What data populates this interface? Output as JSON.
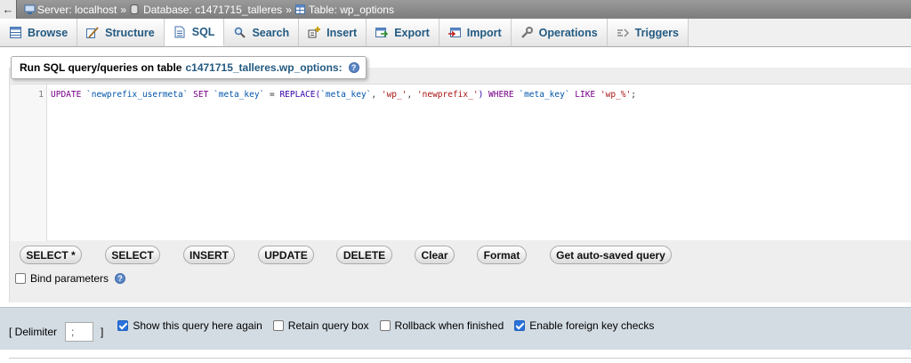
{
  "breadcrumb": {
    "back_glyph": "←",
    "server": "Server: localhost",
    "database": "Database: c1471715_talleres",
    "table": "Table: wp_options",
    "separator": "»"
  },
  "tabs": [
    {
      "label": "Browse",
      "icon": "browse-icon",
      "active": false
    },
    {
      "label": "Structure",
      "icon": "structure-icon",
      "active": false
    },
    {
      "label": "SQL",
      "icon": "sql-icon",
      "active": true
    },
    {
      "label": "Search",
      "icon": "search-icon",
      "active": false
    },
    {
      "label": "Insert",
      "icon": "insert-icon",
      "active": false
    },
    {
      "label": "Export",
      "icon": "export-icon",
      "active": false
    },
    {
      "label": "Import",
      "icon": "import-icon",
      "active": false
    },
    {
      "label": "Operations",
      "icon": "wrench-icon",
      "active": false
    },
    {
      "label": "Triggers",
      "icon": "triggers-icon",
      "active": false
    }
  ],
  "query_panel": {
    "legend_prefix": "Run SQL query/queries on table",
    "table_name": "c1471715_talleres.wp_options:",
    "help_glyph": "?"
  },
  "editor": {
    "line_number": "1",
    "tokens": {
      "t1": "UPDATE",
      "t2": " `newprefix_usermeta` ",
      "t3": "SET",
      "t4": " `meta_key` ",
      "t5": "= ",
      "t6": "REPLACE(",
      "t7": "`meta_key`",
      "t8": ", ",
      "t9": "'wp_'",
      "t10": ", ",
      "t11": "'newprefix_'",
      "t12": ") ",
      "t13": "WHERE",
      "t14": " `meta_key` ",
      "t15": "LIKE",
      "t16": " 'wp_%'",
      "t17": ";"
    }
  },
  "sql_buttons": [
    "SELECT *",
    "SELECT",
    "INSERT",
    "UPDATE",
    "DELETE",
    "Clear",
    "Format",
    "Get auto-saved query"
  ],
  "bind_parameters": {
    "label": "Bind parameters",
    "checked": false
  },
  "options": {
    "delimiter_label_open": "[ Delimiter",
    "delimiter_value": ";",
    "delimiter_label_close": "]",
    "show_query": {
      "label": "Show this query here again",
      "checked": true
    },
    "retain_box": {
      "label": "Retain query box",
      "checked": false
    },
    "rollback": {
      "label": "Rollback when finished",
      "checked": false
    },
    "foreign_keys": {
      "label": "Enable foreign key checks",
      "checked": true
    }
  },
  "colors": {
    "link": "#235a81",
    "accent_checkbox": "#2a73dd",
    "optbar_bg": "#d3dce3"
  }
}
